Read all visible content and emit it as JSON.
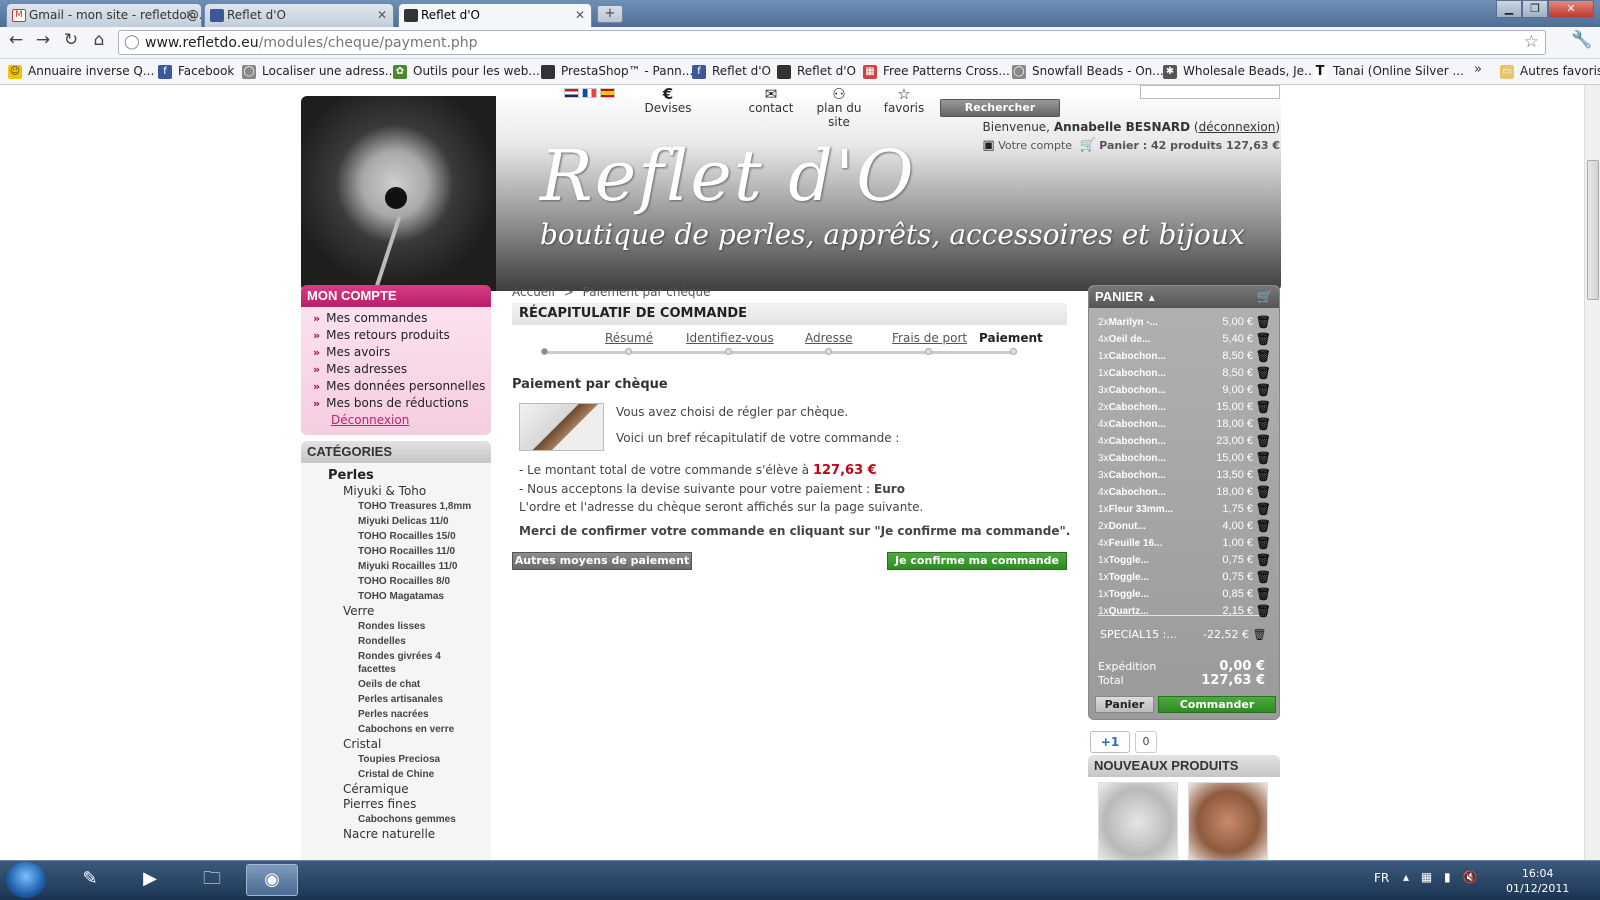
{
  "browser": {
    "tabs": [
      {
        "title": "Gmail - mon site - refletdo@..."
      },
      {
        "title": "Reflet d'O"
      },
      {
        "title": "Reflet d'O"
      }
    ],
    "new_tab_symbol": "+",
    "url_host": "www.refletdo.eu",
    "url_path": "/modules/cheque/payment.php",
    "bookmarks": [
      "Annuaire inverse  Q...",
      "Facebook",
      "Localiser une adress...",
      "Outils pour les web...",
      "PrestaShop™ - Pann...",
      "Reflet d'O",
      "Reflet d'O",
      "Free Patterns Cross...",
      "Snowfall Beads - On...",
      "Wholesale Beads, Je...",
      "Tanai (Online Silver ..."
    ],
    "bookmarks_more": "»",
    "other_bookmarks": "Autres favoris"
  },
  "header": {
    "logo_title": "Reflet d'O",
    "logo_subtitle": "boutique de perles, apprêts, accessoires et bijoux",
    "currency_symbol": "€",
    "currency_label": "Devises",
    "contact_label": "contact",
    "sitemap_label": "plan du site",
    "favorites_label": "favoris",
    "search_button": "Rechercher",
    "welcome_prefix": "Bienvenue,",
    "user_name": "Annabelle BESNARD",
    "logout_link": "déconnexion",
    "account_link": "Votre compte",
    "cart_summary": "Panier : 42 produits 127,63 €"
  },
  "account_menu": {
    "title": "MON COMPTE",
    "items": [
      "Mes commandes",
      "Mes retours produits",
      "Mes avoirs",
      "Mes adresses",
      "Mes données personnelles",
      "Mes bons de réductions"
    ],
    "logout": "Déconnexion"
  },
  "categories": {
    "title": "CATÉGORIES",
    "groups": [
      {
        "label": "Perles",
        "level": 1
      },
      {
        "label": "Miyuki & Toho",
        "level": 2
      },
      {
        "label": "TOHO Treasures 1,8mm",
        "level": 3
      },
      {
        "label": "Miyuki Delicas 11/0",
        "level": 3
      },
      {
        "label": "TOHO Rocailles 15/0",
        "level": 3
      },
      {
        "label": "TOHO Rocailles 11/0",
        "level": 3
      },
      {
        "label": "Miyuki Rocailles 11/0",
        "level": 3
      },
      {
        "label": "TOHO Rocailles 8/0",
        "level": 3
      },
      {
        "label": "TOHO Magatamas",
        "level": 3
      },
      {
        "label": "Verre",
        "level": 2
      },
      {
        "label": "Rondes lisses",
        "level": 3
      },
      {
        "label": "Rondelles",
        "level": 3
      },
      {
        "label": "Rondes givrées 4 facettes",
        "level": 3
      },
      {
        "label": "Oeils de chat",
        "level": 3
      },
      {
        "label": "Perles artisanales",
        "level": 3
      },
      {
        "label": "Perles nacrées",
        "level": 3
      },
      {
        "label": "Cabochons en verre",
        "level": 3
      },
      {
        "label": "Cristal",
        "level": 2
      },
      {
        "label": "Toupies Preciosa",
        "level": 3
      },
      {
        "label": "Cristal de Chine",
        "level": 3
      },
      {
        "label": "Céramique",
        "level": 2
      },
      {
        "label": "Pierres fines",
        "level": 2
      },
      {
        "label": "Cabochons gemmes",
        "level": 3
      },
      {
        "label": "Nacre naturelle",
        "level": 2
      }
    ]
  },
  "breadcrumb": {
    "home": "Accueil",
    "sep": ">",
    "current": "Paiement par chèque"
  },
  "order": {
    "recap_title": "RÉCAPITULATIF DE COMMANDE",
    "steps": [
      "Résumé",
      "Identifiez-vous",
      "Adresse",
      "Frais de port",
      "Paiement"
    ],
    "payment_title": "Paiement par chèque",
    "line1": "Vous avez choisi de régler par chèque.",
    "line2": "Voici un bref récapitulatif de votre commande :",
    "total_prefix": "- Le montant total de votre commande s'élève à",
    "total_amount": "127,63 €",
    "currency_prefix": "- Nous acceptons la devise suivante pour votre paiement :",
    "currency_value": "Euro",
    "address_note": "L'ordre et l'adresse du chèque seront affichés sur la page suivante.",
    "confirm_msg": "Merci de confirmer votre commande en cliquant sur \"Je confirme ma commande\".",
    "other_methods_btn": "Autres moyens de paiement",
    "confirm_btn": "Je confirme ma commande"
  },
  "cart": {
    "title": "PANIER",
    "items": [
      {
        "qty": "2x",
        "name": "Marilyn -...",
        "price": "5,00 €"
      },
      {
        "qty": "4x",
        "name": "Oeil de...",
        "price": "5,40 €"
      },
      {
        "qty": "1x",
        "name": "Cabochon...",
        "price": "8,50 €"
      },
      {
        "qty": "1x",
        "name": "Cabochon...",
        "price": "8,50 €"
      },
      {
        "qty": "3x",
        "name": "Cabochon...",
        "price": "9,00 €"
      },
      {
        "qty": "2x",
        "name": "Cabochon...",
        "price": "15,00 €"
      },
      {
        "qty": "4x",
        "name": "Cabochon...",
        "price": "18,00 €"
      },
      {
        "qty": "4x",
        "name": "Cabochon...",
        "price": "23,00 €"
      },
      {
        "qty": "3x",
        "name": "Cabochon...",
        "price": "15,00 €"
      },
      {
        "qty": "3x",
        "name": "Cabochon...",
        "price": "13,50 €"
      },
      {
        "qty": "4x",
        "name": "Cabochon...",
        "price": "18,00 €"
      },
      {
        "qty": "1x",
        "name": "Fleur 33mm...",
        "price": "1,75 €"
      },
      {
        "qty": "2x",
        "name": "Donut...",
        "price": "4,00 €"
      },
      {
        "qty": "4x",
        "name": "Feuille 16...",
        "price": "1,00 €"
      },
      {
        "qty": "1x",
        "name": "Toggle...",
        "price": "0,75 €"
      },
      {
        "qty": "1x",
        "name": "Toggle...",
        "price": "0,75 €"
      },
      {
        "qty": "1x",
        "name": "Toggle...",
        "price": "0,85 €"
      },
      {
        "qty": "1x",
        "name": "Quartz...",
        "price": "2,15 €"
      }
    ],
    "discount_label": "SPECIAL15 :...",
    "discount_value": "-22,52 €",
    "shipping_label": "Expédition",
    "shipping_value": "0,00 €",
    "total_label": "Total",
    "total_value": "127,63 €",
    "panier_btn": "Panier",
    "commander_btn": "Commander"
  },
  "social": {
    "plus_one": "+1",
    "count": "0"
  },
  "new_products": {
    "title": "NOUVEAUX PRODUITS"
  },
  "taskbar": {
    "lang": "FR",
    "time": "16:04",
    "date": "01/12/2011"
  }
}
